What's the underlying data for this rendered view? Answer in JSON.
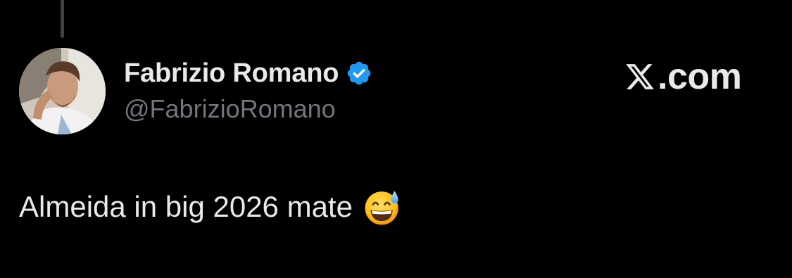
{
  "tweet": {
    "author": {
      "display_name": "Fabrizio Romano",
      "handle": "@FabrizioRomano",
      "verified": true,
      "avatar_icon": "profile-photo"
    },
    "brand": {
      "logo_icon": "x-logo-icon",
      "text": ".com"
    },
    "text": "Almeida in big 2026 mate",
    "emoji_icon": "grinning-face-with-sweat-emoji"
  },
  "colors": {
    "background": "#000000",
    "primary_text": "#e7e9ea",
    "secondary_text": "#71767b",
    "verified_blue": "#1d9bf0",
    "thread_line": "#3e4144"
  }
}
